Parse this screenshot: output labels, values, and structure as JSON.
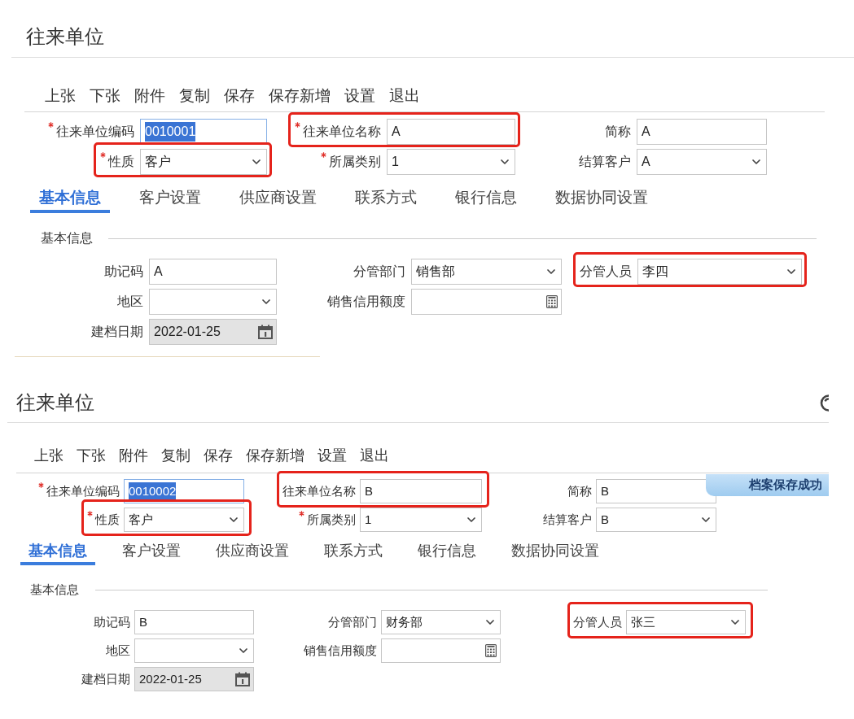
{
  "panels": [
    {
      "title": "往来单位",
      "help_button": false,
      "toolbar": [
        "上张",
        "下张",
        "附件",
        "复制",
        "保存",
        "保存新增",
        "设置",
        "退出"
      ],
      "header_rows": [
        [
          {
            "kind": "text",
            "label": "往来单位编码",
            "required": true,
            "value": "0010001",
            "focused": true,
            "text_selected": true,
            "disabled": false,
            "highlighted": false
          },
          {
            "kind": "text",
            "label": "往来单位名称",
            "required": true,
            "value": "A",
            "focused": false,
            "text_selected": false,
            "disabled": false,
            "highlighted": true
          },
          {
            "kind": "text",
            "label": "简称",
            "required": false,
            "value": "A",
            "focused": false,
            "text_selected": false,
            "disabled": false,
            "highlighted": false
          }
        ],
        [
          {
            "kind": "select",
            "label": "性质",
            "required": true,
            "value": "客户",
            "focused": false,
            "text_selected": false,
            "disabled": false,
            "highlighted": true
          },
          {
            "kind": "select",
            "label": "所属类别",
            "required": true,
            "value": "1",
            "focused": false,
            "text_selected": false,
            "disabled": false,
            "highlighted": false
          },
          {
            "kind": "select",
            "label": "结算客户",
            "required": false,
            "value": "A",
            "focused": false,
            "text_selected": false,
            "disabled": false,
            "highlighted": false
          }
        ]
      ],
      "tabs": [
        {
          "label": "基本信息",
          "selected": true
        },
        {
          "label": "客户设置",
          "selected": false
        },
        {
          "label": "供应商设置",
          "selected": false
        },
        {
          "label": "联系方式",
          "selected": false
        },
        {
          "label": "银行信息",
          "selected": false
        },
        {
          "label": "数据协同设置",
          "selected": false
        }
      ],
      "section": {
        "title": "基本信息"
      },
      "basic_rows": [
        [
          {
            "kind": "text",
            "label": "助记码",
            "required": false,
            "value": "A",
            "focused": false,
            "text_selected": false,
            "disabled": false,
            "highlighted": false
          },
          {
            "kind": "select",
            "label": "分管部门",
            "required": false,
            "value": "销售部",
            "focused": false,
            "text_selected": false,
            "disabled": false,
            "highlighted": false
          },
          {
            "kind": "select",
            "label": "分管人员",
            "required": false,
            "value": "李四",
            "focused": false,
            "text_selected": false,
            "disabled": false,
            "highlighted": true
          }
        ],
        [
          {
            "kind": "select",
            "label": "地区",
            "required": false,
            "focused": false,
            "disabled": false,
            "highlighted": false
          },
          {
            "kind": "number",
            "label": "销售信用额度",
            "required": false,
            "focused": false,
            "disabled": false,
            "highlighted": false
          }
        ],
        [
          {
            "kind": "date",
            "label": "建档日期",
            "required": false,
            "value": "2022-01-25",
            "focused": false,
            "text_selected": false,
            "disabled": true,
            "highlighted": false
          }
        ]
      ]
    },
    {
      "title": "往来单位",
      "help_button": true,
      "toolbar": [
        "上张",
        "下张",
        "附件",
        "复制",
        "保存",
        "保存新增",
        "设置",
        "退出"
      ],
      "header_rows": [
        [
          {
            "kind": "text",
            "label": "往来单位编码",
            "required": true,
            "value": "0010002",
            "focused": true,
            "text_selected": true,
            "disabled": false,
            "highlighted": false
          },
          {
            "kind": "text",
            "label": "往来单位名称",
            "required": false,
            "value": "B",
            "focused": false,
            "text_selected": false,
            "disabled": false,
            "highlighted": true
          },
          {
            "kind": "text",
            "label": "简称",
            "required": false,
            "value": "B",
            "focused": false,
            "text_selected": false,
            "disabled": false,
            "highlighted": false
          }
        ],
        [
          {
            "kind": "select",
            "label": "性质",
            "required": true,
            "value": "客户",
            "focused": false,
            "text_selected": false,
            "disabled": false,
            "highlighted": true
          },
          {
            "kind": "select",
            "label": "所属类别",
            "required": true,
            "value": "1",
            "focused": false,
            "text_selected": false,
            "disabled": false,
            "highlighted": false
          },
          {
            "kind": "select",
            "label": "结算客户",
            "required": false,
            "value": "B",
            "focused": false,
            "text_selected": false,
            "disabled": false,
            "highlighted": false
          }
        ]
      ],
      "tabs": [
        {
          "label": "基本信息",
          "selected": true
        },
        {
          "label": "客户设置",
          "selected": false
        },
        {
          "label": "供应商设置",
          "selected": false
        },
        {
          "label": "联系方式",
          "selected": false
        },
        {
          "label": "银行信息",
          "selected": false
        },
        {
          "label": "数据协同设置",
          "selected": false
        }
      ],
      "section": {
        "title": "基本信息"
      },
      "basic_rows": [
        [
          {
            "kind": "text",
            "label": "助记码",
            "required": false,
            "value": "B",
            "focused": false,
            "text_selected": false,
            "disabled": false,
            "highlighted": false
          },
          {
            "kind": "select",
            "label": "分管部门",
            "required": false,
            "value": "财务部",
            "focused": false,
            "text_selected": false,
            "disabled": false,
            "highlighted": false
          },
          {
            "kind": "select",
            "label": "分管人员",
            "required": false,
            "value": "张三",
            "focused": false,
            "text_selected": false,
            "disabled": false,
            "highlighted": true
          }
        ],
        [
          {
            "kind": "select",
            "label": "地区",
            "required": false,
            "focused": false,
            "disabled": false,
            "highlighted": false
          },
          {
            "kind": "number",
            "label": "销售信用额度",
            "required": false,
            "focused": false,
            "disabled": false,
            "highlighted": false
          }
        ],
        [
          {
            "kind": "date",
            "label": "建档日期",
            "required": false,
            "value": "2022-01-25",
            "focused": false,
            "text_selected": false,
            "disabled": true,
            "highlighted": false
          }
        ]
      ],
      "toast": {
        "message": "档案保存成功"
      }
    }
  ]
}
